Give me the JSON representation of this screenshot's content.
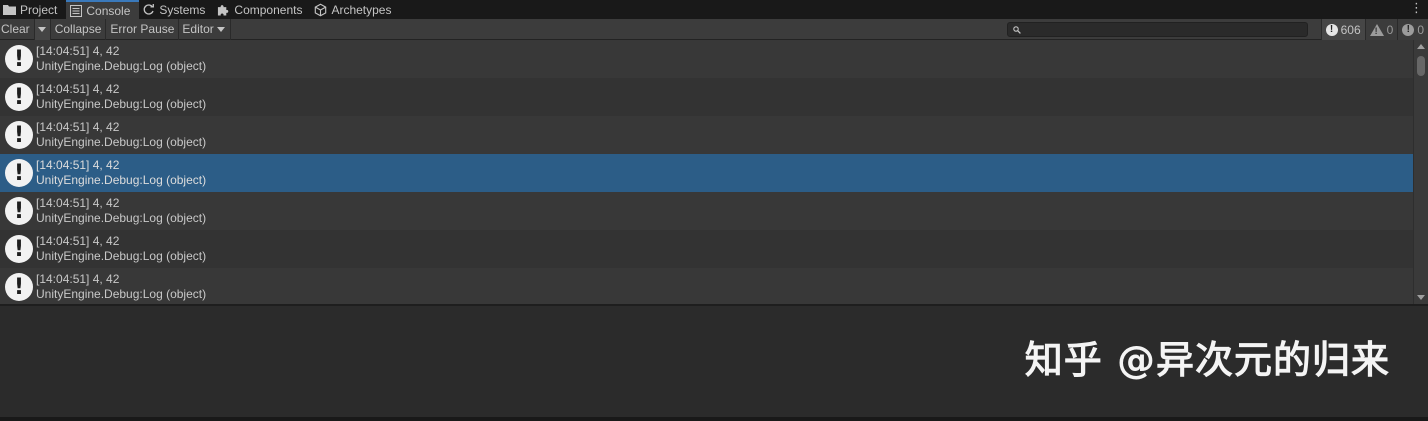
{
  "tabs": [
    {
      "label": "Project",
      "icon": "folder-icon",
      "active": false
    },
    {
      "label": "Console",
      "icon": "console-icon",
      "active": true
    },
    {
      "label": "Systems",
      "icon": "refresh-icon",
      "active": false
    },
    {
      "label": "Components",
      "icon": "puzzle-icon",
      "active": false
    },
    {
      "label": "Archetypes",
      "icon": "cube-icon",
      "active": false
    }
  ],
  "toolbar": {
    "clear_label": "Clear",
    "collapse_label": "Collapse",
    "error_pause_label": "Error Pause",
    "editor_label": "Editor",
    "search_value": ""
  },
  "counters": {
    "log_count": "606",
    "warning_count": "0",
    "error_count": "0"
  },
  "logs": [
    {
      "line1": "[14:04:51] 4, 42",
      "line2": "UnityEngine.Debug:Log (object)"
    },
    {
      "line1": "[14:04:51] 4, 42",
      "line2": "UnityEngine.Debug:Log (object)"
    },
    {
      "line1": "[14:04:51] 4, 42",
      "line2": "UnityEngine.Debug:Log (object)"
    },
    {
      "line1": "[14:04:51] 4, 42",
      "line2": "UnityEngine.Debug:Log (object)"
    },
    {
      "line1": "[14:04:51] 4, 42",
      "line2": "UnityEngine.Debug:Log (object)"
    },
    {
      "line1": "[14:04:51] 4, 42",
      "line2": "UnityEngine.Debug:Log (object)"
    },
    {
      "line1": "[14:04:51] 4, 42",
      "line2": "UnityEngine.Debug:Log (object)"
    }
  ],
  "selected_index": 3,
  "watermark": "知乎 @异次元的归来",
  "colors": {
    "selection": "#2c5d87",
    "tab_accent": "#3a79bb"
  }
}
